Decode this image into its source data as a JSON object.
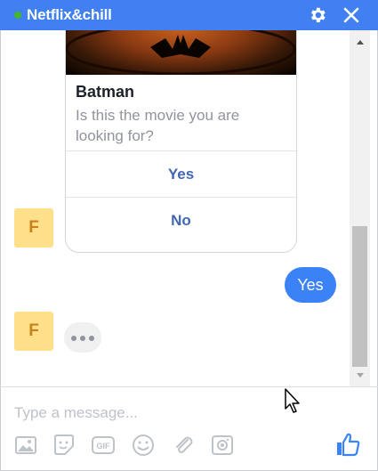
{
  "header": {
    "title": "Netflix&chill",
    "status_color": "#42b72a",
    "background": "#4080f0",
    "icons": [
      "gear-icon",
      "close-icon"
    ]
  },
  "card": {
    "title": "Batman",
    "subtitle": "Is this the movie you are looking for?",
    "buttons": [
      {
        "label": "Yes"
      },
      {
        "label": "No"
      }
    ]
  },
  "bot": {
    "avatar_letter": "F"
  },
  "user_message": "Yes",
  "composer": {
    "placeholder": "Type a message...",
    "tools": [
      "image-icon",
      "sticker-icon",
      "gif-icon",
      "emoji-icon",
      "attachment-icon",
      "camera-icon",
      "like-icon"
    ]
  }
}
